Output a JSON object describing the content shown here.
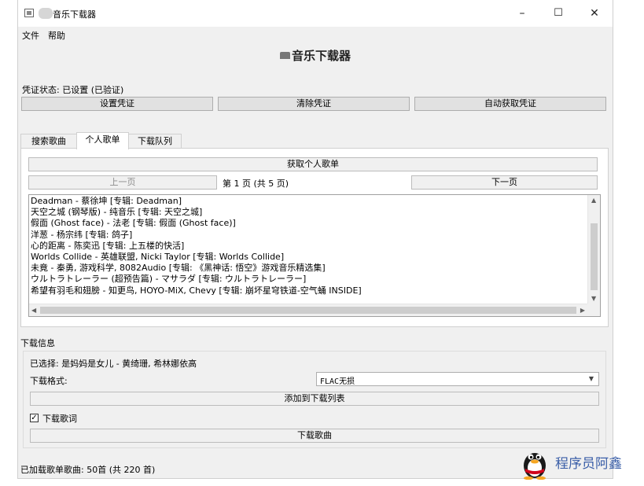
{
  "window": {
    "title": "音乐下载器",
    "minimize_glyph": "–",
    "maximize_glyph": "☐",
    "close_glyph": "✕"
  },
  "menubar": {
    "items": [
      "文件",
      "帮助"
    ]
  },
  "header": {
    "title": "音乐下载器",
    "icon": "cloud-icon"
  },
  "credentials": {
    "status": "凭证状态: 已设置 (已验证)",
    "set_button": "设置凭证",
    "clear_button": "清除凭证",
    "auto_button": "自动获取凭证"
  },
  "tabs": [
    {
      "label": "搜索歌曲",
      "active": false
    },
    {
      "label": "个人歌单",
      "active": true
    },
    {
      "label": "下载队列",
      "active": false
    }
  ],
  "playlist": {
    "fetch_button": "获取个人歌单",
    "prev_button": "上一页",
    "page_label": "第 1 页 (共 5 页)",
    "next_button": "下一页",
    "songs": [
      "Deadman - 蔡徐坤 [专辑: Deadman]",
      "天空之城 (钢琴版) - 纯音乐 [专辑: 天空之城]",
      "假面 (Ghost face) - 法老 [专辑: 假面 (Ghost face)]",
      "洋葱 - 杨宗纬 [专辑: 鸽子]",
      "心的距离 - 陈奕迅 [专辑: 上五楼的快活]",
      "Worlds Collide - 英雄联盟, Nicki Taylor [专辑: Worlds Collide]",
      "未竟 - 秦勇, 游戏科学, 8082Audio [专辑: 《黑神话: 悟空》游戏音乐精选集]",
      "ウルトラトレーラー (超预告篇) - マサラダ [专辑: ウルトラトレーラー]",
      "希望有羽毛和翅膀 - 知更鸟, HOYO-MiX, Chevy [专辑: 崩坏星穹铁道-空气蛹 INSIDE]"
    ]
  },
  "download": {
    "section_title": "下载信息",
    "selected": "已选择: 是妈妈是女儿 - 黄绮珊, 希林娜依高",
    "format_label": "下载格式:",
    "format_value": "FLAC无损",
    "add_to_queue_button": "添加到下载列表",
    "download_lyrics_label": "下载歌词",
    "download_lyrics_checked": true,
    "check_glyph": "✓",
    "download_button": "下载歌曲"
  },
  "status_bar": {
    "text": "已加载歌单歌曲: 50首 (共 220 首)"
  },
  "watermark": {
    "text": "程序员阿鑫",
    "icon": "penguin-icon"
  },
  "colors": {
    "window_bg": "#f0f0f0",
    "list_bg": "#ffffff",
    "watermark_blue": "#3b5fa8"
  }
}
